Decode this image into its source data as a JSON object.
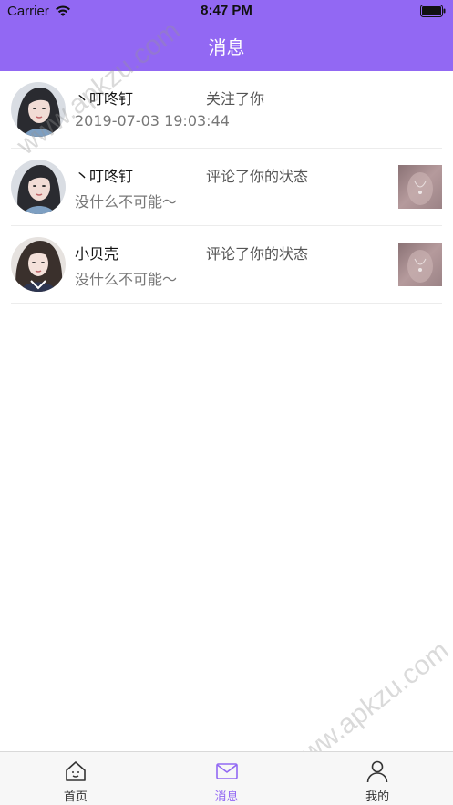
{
  "status_bar": {
    "carrier": "Carrier",
    "time": "8:47 PM"
  },
  "nav": {
    "title": "消息"
  },
  "colors": {
    "accent": "#9268f3"
  },
  "messages": [
    {
      "name": "丶叮咚钉",
      "action": "关注了你",
      "sub": "2019-07-03 19:03:44",
      "has_thumb": false
    },
    {
      "name": "丶叮咚钉",
      "action": "评论了你的状态",
      "sub": "没什么不可能～",
      "has_thumb": true
    },
    {
      "name": "小贝壳",
      "action": "评论了你的状态",
      "sub": "没什么不可能～",
      "has_thumb": true
    }
  ],
  "tabs": [
    {
      "label": "首页",
      "icon": "home-icon",
      "active": false
    },
    {
      "label": "消息",
      "icon": "mail-icon",
      "active": true
    },
    {
      "label": "我的",
      "icon": "person-icon",
      "active": false
    }
  ],
  "watermark": "www.apkzu.com"
}
